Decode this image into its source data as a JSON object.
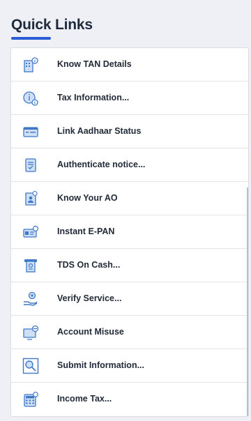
{
  "quick_links": {
    "title": "Quick Links",
    "items": [
      {
        "label": "Know TAN Details",
        "icon": "building-info-icon"
      },
      {
        "label": "Tax Information...",
        "icon": "info-coin-icon"
      },
      {
        "label": "Link Aadhaar Status",
        "icon": "id-card-link-icon"
      },
      {
        "label": "Authenticate notice...",
        "icon": "document-check-icon"
      },
      {
        "label": "Know Your AO",
        "icon": "officer-document-icon"
      },
      {
        "label": "Instant E-PAN",
        "icon": "pan-card-icon"
      },
      {
        "label": "TDS On Cash...",
        "icon": "cash-withdrawal-icon"
      },
      {
        "label": "Verify Service...",
        "icon": "hand-gear-icon"
      },
      {
        "label": "Account Misuse",
        "icon": "monitor-block-icon"
      },
      {
        "label": "Submit Information...",
        "icon": "search-monitor-icon"
      },
      {
        "label": "Income Tax...",
        "icon": "calculator-icon"
      }
    ]
  },
  "colors": {
    "accent": "#2a5dd6",
    "icon_blue": "#3f78c9",
    "icon_light": "#cfe0f5",
    "text": "#222b38"
  }
}
